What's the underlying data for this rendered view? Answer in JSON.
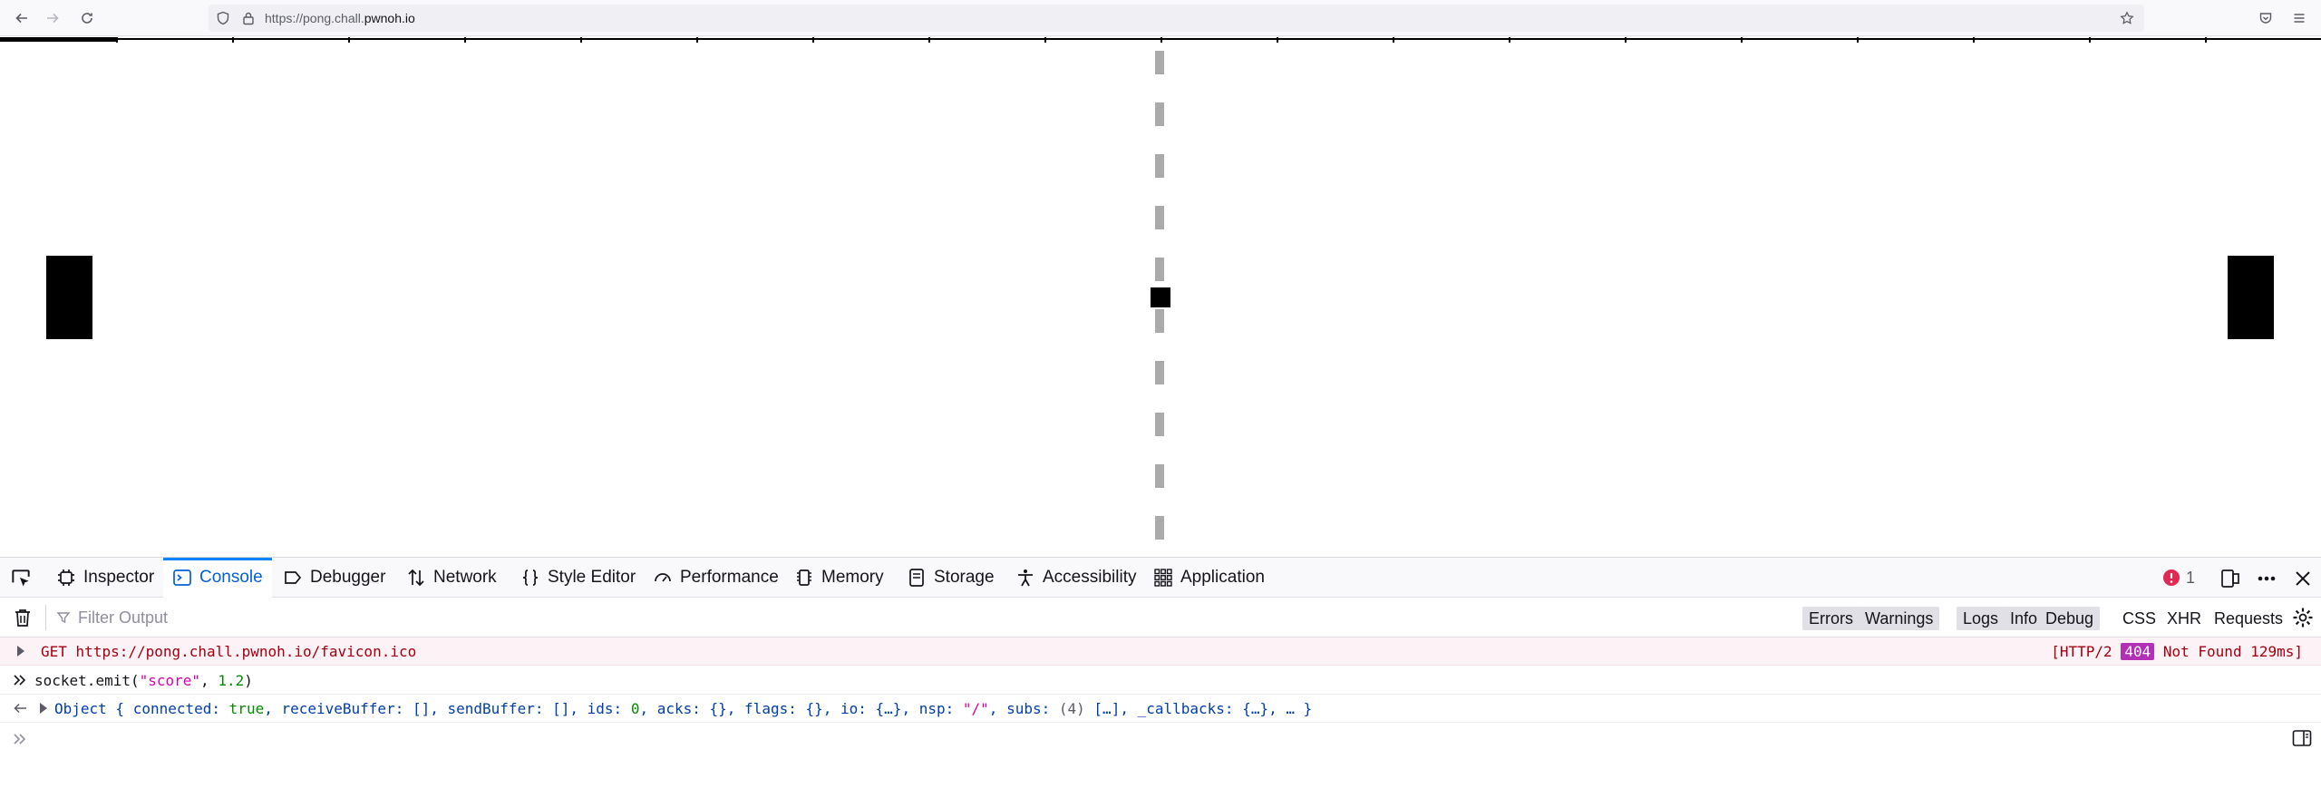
{
  "browser": {
    "url_prefix": "https://pong.chall.",
    "url_domain": "pwnoh.io",
    "back_icon": "arrow-left-icon",
    "forward_icon": "arrow-right-icon",
    "reload_icon": "reload-icon"
  },
  "devtools": {
    "tabs": [
      {
        "label": "Inspector",
        "icon": "inspector-icon"
      },
      {
        "label": "Console",
        "icon": "console-icon",
        "active": true
      },
      {
        "label": "Debugger",
        "icon": "debugger-icon"
      },
      {
        "label": "Network",
        "icon": "network-icon"
      },
      {
        "label": "Style Editor",
        "icon": "style-editor-icon"
      },
      {
        "label": "Performance",
        "icon": "performance-icon"
      },
      {
        "label": "Memory",
        "icon": "memory-icon"
      },
      {
        "label": "Storage",
        "icon": "storage-icon"
      },
      {
        "label": "Accessibility",
        "icon": "accessibility-icon"
      },
      {
        "label": "Application",
        "icon": "application-icon"
      }
    ],
    "error_count": "1",
    "filter_placeholder": "Filter Output",
    "levels": [
      "Errors",
      "Warnings",
      "Logs",
      "Info",
      "Debug"
    ],
    "extra_filters": [
      "CSS",
      "XHR",
      "Requests"
    ],
    "messages": {
      "error": {
        "method": "GET",
        "url": "https://pong.chall.pwnoh.io/favicon.ico",
        "protocol": "[HTTP/2",
        "code": "404",
        "status_text": "Not Found 129ms]"
      },
      "input": {
        "obj": "socket",
        "fn": "emit",
        "arg_str": "\"score\"",
        "arg_num": "1.2"
      },
      "result": {
        "head": "Object {",
        "connected_key": "connected:",
        "connected_val": "true",
        "rb": "receiveBuffer: [],",
        "sb": "sendBuffer: [],",
        "ids_key": "ids:",
        "ids_val": "0",
        "rest1": "acks: {}, flags: {}, io: {…},",
        "nsp_key": "nsp:",
        "nsp_val": "\"/\"",
        "subs_key": "subs:",
        "subs_count": "(4)",
        "rest2": "[…], _callbacks: {…}, … }"
      }
    }
  }
}
